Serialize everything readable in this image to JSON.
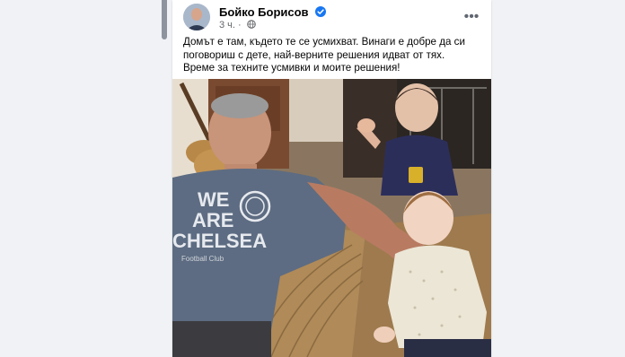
{
  "post": {
    "author_name": "Бойко Борисов",
    "time": "3 ч.",
    "privacy_icon": "globe-icon",
    "verified_icon": "verified-badge-icon",
    "more_icon": "more-options-icon",
    "more_glyph": "•••",
    "text": "Домът е там, където те се усмихват. Винаги е добре да си поговориш с дете, най-верните решения идват от тях. Време за техните усмивки и моите решения!",
    "photo": {
      "shirt_text_line1": "WE",
      "shirt_text_line2": "ARE",
      "shirt_text_line3": "CHELSEA",
      "shirt_small_text": "Football Club"
    }
  },
  "colors": {
    "background": "#f0f2f5",
    "card": "#ffffff",
    "text": "#050505",
    "secondary_text": "#65676b",
    "verified": "#1877f2"
  }
}
